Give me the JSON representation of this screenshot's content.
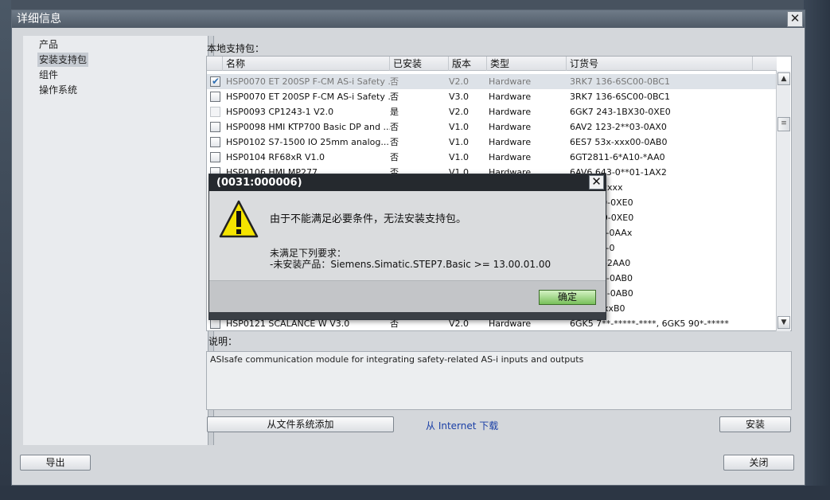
{
  "window": {
    "title": "详细信息",
    "close_glyph": "✕"
  },
  "nav": {
    "items": [
      {
        "label": "产品"
      },
      {
        "label": "安装支持包"
      },
      {
        "label": "组件"
      },
      {
        "label": "操作系统"
      }
    ]
  },
  "packages": {
    "section_label": "本地支持包：",
    "columns": [
      "名称",
      "已安装",
      "版本",
      "类型",
      "订货号"
    ],
    "rows": [
      {
        "name": "HSP0070 ET 200SP F-CM AS-i Safety ...",
        "installed": "否",
        "version": "V2.0",
        "type": "Hardware",
        "order": "3RK7 136-6SC00-0BC1",
        "checked": true,
        "selected": true
      },
      {
        "name": "HSP0070 ET 200SP F-CM AS-i Safety ...",
        "installed": "否",
        "version": "V3.0",
        "type": "Hardware",
        "order": "3RK7 136-6SC00-0BC1",
        "checked": false,
        "selected": false
      },
      {
        "name": "HSP0093 CP1243-1 V2.0",
        "installed": "是",
        "version": "V2.0",
        "type": "Hardware",
        "order": "6GK7 243-1BX30-0XE0",
        "checked": false,
        "disabled": true
      },
      {
        "name": "HSP0098 HMI KTP700 Basic DP and ...",
        "installed": "否",
        "version": "V1.0",
        "type": "Hardware",
        "order": "6AV2 123-2**03-0AX0",
        "checked": false
      },
      {
        "name": "HSP0102 S7-1500 IO 25mm analog...",
        "installed": "否",
        "version": "V1.0",
        "type": "Hardware",
        "order": "6ES7 53x-xxx00-0AB0",
        "checked": false
      },
      {
        "name": "HSP0104 RF68xR V1.0",
        "installed": "否",
        "version": "V1.0",
        "type": "Hardware",
        "order": "6GT2811-6*A10-*AA0",
        "checked": false
      },
      {
        "name": "HSP0106 HMI MP277",
        "installed": "否",
        "version": "V1.0",
        "type": "Hardware",
        "order": "6AV6 643-0**01-1AX2",
        "checked": false
      },
      {
        "name": "",
        "installed": "",
        "version": "",
        "type": "",
        "order": "-xxxxx-xxxx",
        "checked": false
      },
      {
        "name": "",
        "installed": "",
        "version": "",
        "type": "",
        "order": "3-8RX30-0XE0",
        "checked": false
      },
      {
        "name": "",
        "installed": "",
        "version": "",
        "type": "",
        "order": "3-1HX30-0XE0",
        "checked": false
      },
      {
        "name": "",
        "installed": "",
        "version": "",
        "type": "",
        "order": "3-xxA00-0AAx",
        "checked": false
      },
      {
        "name": "",
        "installed": "",
        "version": "",
        "type": "",
        "order": "x-1Ax00-0",
        "checked": false
      },
      {
        "name": "",
        "installed": "",
        "version": "",
        "type": "",
        "order": "5-7CJ00-2AA0",
        "checked": false
      },
      {
        "name": "",
        "installed": "",
        "version": "",
        "type": "",
        "order": "1-1Bx00-0AB0",
        "checked": false
      },
      {
        "name": "",
        "installed": "",
        "version": "",
        "type": "",
        "order": "2-5xH00-0AB0",
        "checked": false
      },
      {
        "name": "",
        "installed": "",
        "version": "",
        "type": "",
        "order": "-1xx40-xxB0",
        "checked": false
      },
      {
        "name": "HSP0121 SCALANCE W V3.0",
        "installed": "否",
        "version": "V2.0",
        "type": "Hardware",
        "order": "6GK5 7**-*****-****, 6GK5 90*-*****",
        "checked": false
      }
    ]
  },
  "description": {
    "label": "说明：",
    "text": "ASIsafe communication module for integrating safety-related AS-i inputs and outputs"
  },
  "actions": {
    "add_from_fs": "从文件系统添加",
    "download_link": "从 Internet 下载",
    "install": "安装",
    "export": "导出",
    "close": "关闭"
  },
  "modal": {
    "title": "(0031:000006)",
    "close_glyph": "✕",
    "message": "由于不能满足必要条件，无法安装支持包。",
    "req_heading": "未满足下列要求：",
    "req_item": "-未安装产品：Siemens.Simatic.STEP7.Basic >= 13.00.01.00",
    "ok": "确定"
  },
  "colors": {
    "title_bar": "#4f5a67",
    "modal_title": "#25292e",
    "ok_button": "#78c05a",
    "link": "#1a3fa6"
  }
}
